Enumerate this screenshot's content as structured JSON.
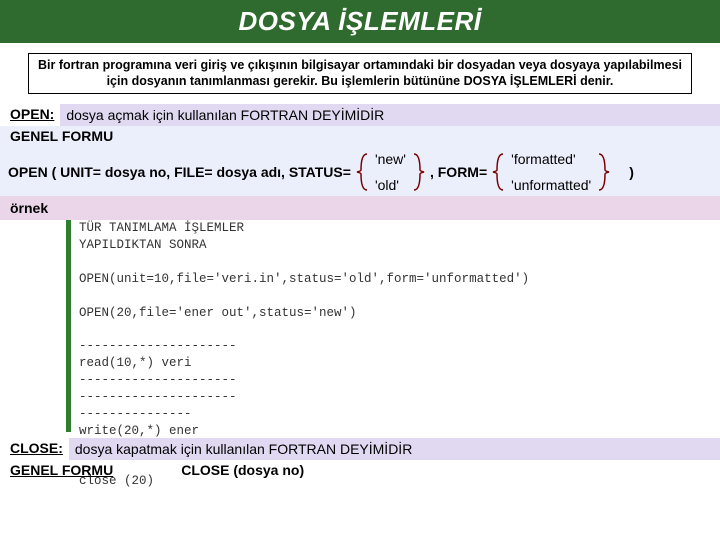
{
  "title": "DOSYA İŞLEMLERİ",
  "intro": "Bir fortran programına veri giriş ve çıkışının bilgisayar ortamındaki bir dosyadan veya dosyaya yapılabilmesi için dosyanın tanımlanması gerekir. Bu işlemlerin bütününe DOSYA İŞLEMLERİ denir.",
  "open_row": {
    "kw": "OPEN:",
    "desc": "dosya açmak için kullanılan FORTRAN DEYİMİDİR"
  },
  "genel_formu": "GENEL FORMU",
  "open_syntax": {
    "lead": "OPEN ( UNIT= dosya no, FILE= dosya adı, STATUS=",
    "alt1_top": "'new'",
    "alt1_bot": "'old'",
    "mid": ", FORM=",
    "alt2_top": "'formatted'",
    "alt2_bot": "'unformatted'",
    "tail": ")"
  },
  "ornek": "örnek",
  "code": "TÜR TANIMLAMA İŞLEMLER\nYAPILDIKTAN SONRA\n\nOPEN(unit=10,file='veri.in',status='old',form='unformatted')\n\nOPEN(20,file='ener out',status='new')\n\n---------------------\nread(10,*) veri\n---------------------\n---------------------\n---------------\nwrite(20,*) ener\n---------------\n\nclose (20)",
  "close_row": {
    "kw": "CLOSE:",
    "desc": "dosya kapatmak için kullanılan FORTRAN DEYİMİDİR"
  },
  "close_syntax": "CLOSE (dosya no)"
}
